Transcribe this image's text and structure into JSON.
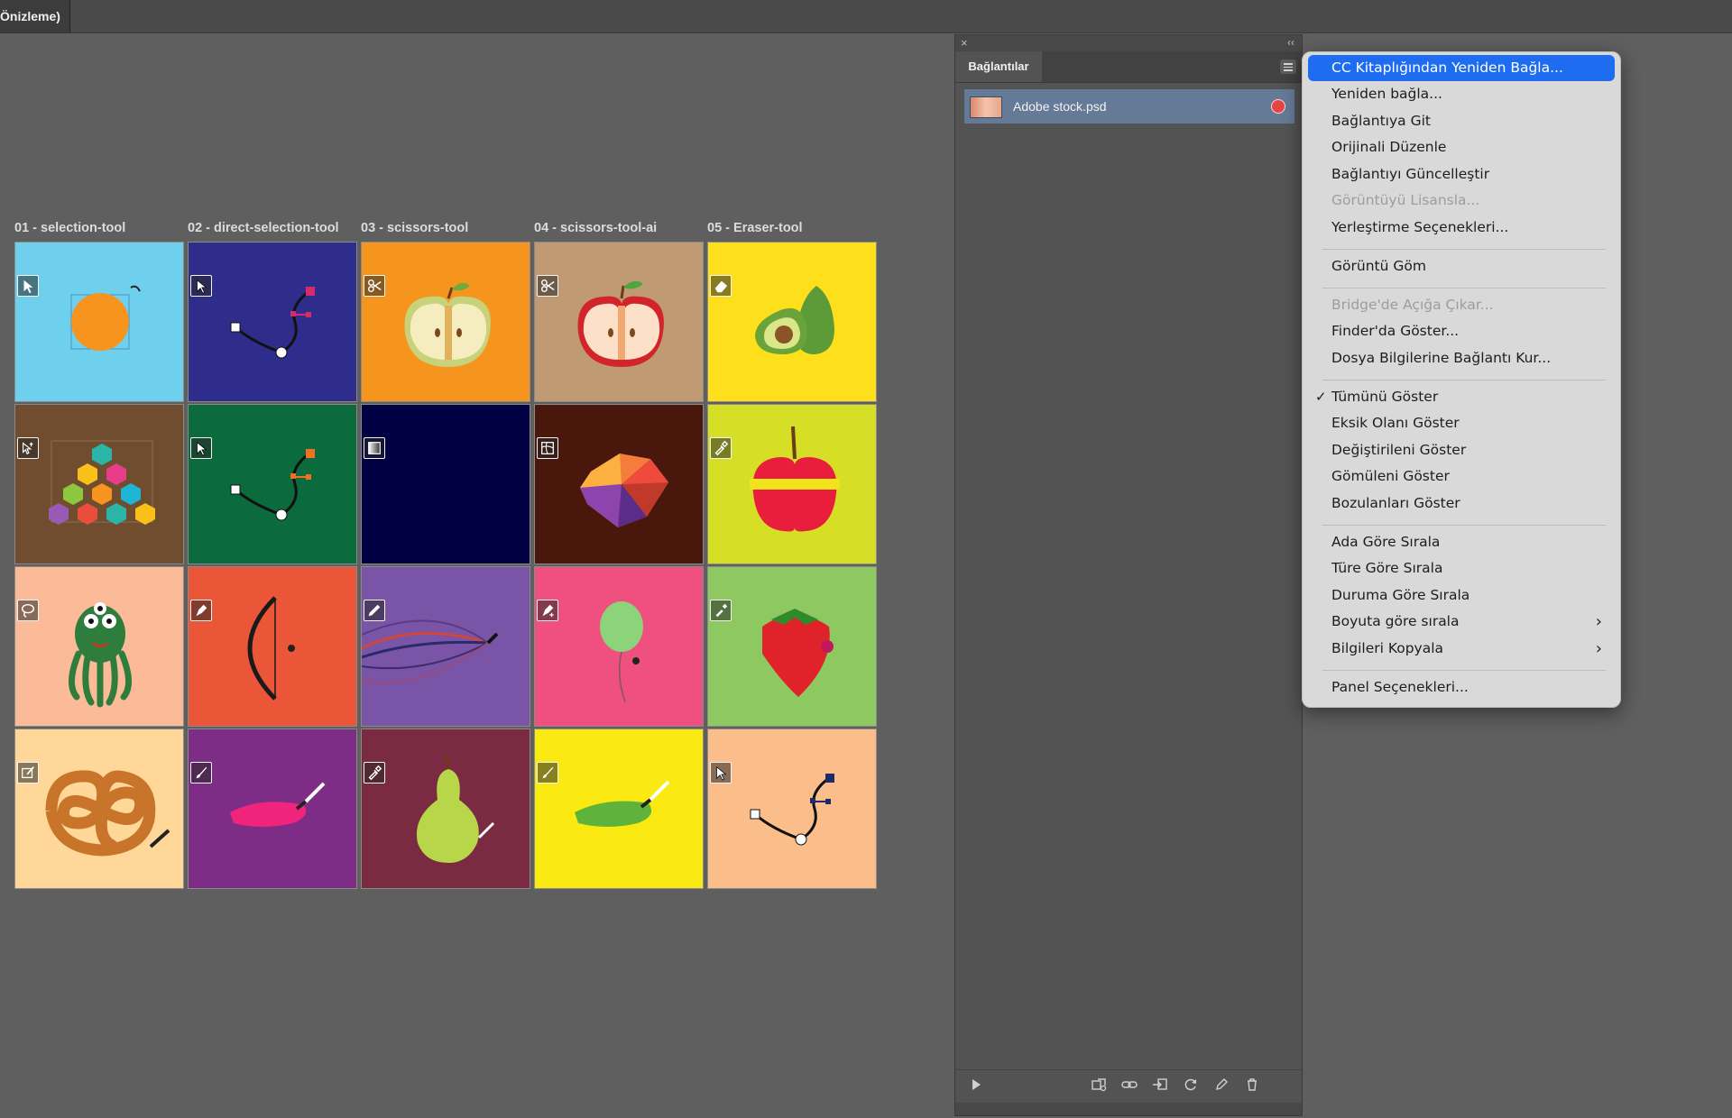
{
  "document": {
    "tab_title": "Önizleme)"
  },
  "artboards": {
    "labels": [
      "01 - selection-tool",
      "02 - direct-selection-tool",
      "03 - scissors-tool",
      "04 - scissors-tool-ai",
      "05 - Eraser-tool"
    ]
  },
  "tiles": [
    {
      "bg": "#6fd0ee",
      "badge": "selection-arrow",
      "art": "orange-circle"
    },
    {
      "bg": "#2f2d8c",
      "badge": "direct-selection-arrow",
      "art": "bezier-path"
    },
    {
      "bg": "#f6951e",
      "badge": "scissors",
      "art": "apple-half-green"
    },
    {
      "bg": "#bf9a72",
      "badge": "scissors",
      "art": "apple-half-red"
    },
    {
      "bg": "#fde01b",
      "badge": "eraser",
      "art": "avocados"
    },
    {
      "bg": "#6f4d2e",
      "badge": "group-selection",
      "art": "hexagons"
    },
    {
      "bg": "#0b6b3c",
      "badge": "direct-selection-arrow",
      "art": "bezier-path-orange"
    },
    {
      "bg": "#000043",
      "badge": "gradient",
      "art": "none"
    },
    {
      "bg": "#4a170c",
      "badge": "mesh",
      "art": "gem"
    },
    {
      "bg": "#d6df25",
      "badge": "eyedropper",
      "art": "apple-red"
    },
    {
      "bg": "#fcbb98",
      "badge": "lasso",
      "art": "octopus"
    },
    {
      "bg": "#ec5638",
      "badge": "pen",
      "art": "bow"
    },
    {
      "bg": "#7a55a7",
      "badge": "pencil",
      "art": "wires"
    },
    {
      "bg": "#ef5080",
      "badge": "pen-add",
      "art": "balloon"
    },
    {
      "bg": "#8dc860",
      "badge": "eyedropper-fill",
      "art": "strawberry"
    },
    {
      "bg": "#ffd899",
      "badge": "blob-brush",
      "art": "pretzel"
    },
    {
      "bg": "#7e2d86",
      "badge": "paintbrush",
      "art": "paint-pink"
    },
    {
      "bg": "#7a2b42",
      "badge": "eyedropper",
      "art": "pear"
    },
    {
      "bg": "#faea12",
      "badge": "paintbrush",
      "art": "paint-green"
    },
    {
      "bg": "#fbbd89",
      "badge": "direct-selection-arrow",
      "art": "bezier-path-navy"
    }
  ],
  "links_panel": {
    "tab_title": "Bağlantılar",
    "close_glyph": "×",
    "collapse_glyph": "‹‹",
    "items": [
      {
        "name": "Adobe stock.psd",
        "status": "modified"
      }
    ]
  },
  "context_menu": {
    "items": [
      {
        "label": "CC Kitaplığından Yeniden Bağla...",
        "state": "highlighted"
      },
      {
        "label": "Yeniden bağla...",
        "state": "enabled"
      },
      {
        "label": "Bağlantıya Git",
        "state": "enabled"
      },
      {
        "label": "Orijinali Düzenle",
        "state": "enabled"
      },
      {
        "label": "Bağlantıyı Güncelleştir",
        "state": "enabled"
      },
      {
        "label": "Görüntüyü Lisansla...",
        "state": "disabled"
      },
      {
        "label": "Yerleştirme Seçenekleri...",
        "state": "enabled"
      },
      {
        "label": "Görüntü Göm",
        "state": "enabled"
      },
      {
        "label": "Bridge'de Açığa Çıkar...",
        "state": "disabled"
      },
      {
        "label": "Finder'da Göster...",
        "state": "enabled"
      },
      {
        "label": "Dosya Bilgilerine Bağlantı Kur...",
        "state": "enabled"
      },
      {
        "label": "Tümünü Göster",
        "state": "checked"
      },
      {
        "label": "Eksik Olanı Göster",
        "state": "enabled"
      },
      {
        "label": "Değiştirileni Göster",
        "state": "enabled"
      },
      {
        "label": "Gömüleni Göster",
        "state": "enabled"
      },
      {
        "label": "Bozulanları Göster",
        "state": "enabled"
      },
      {
        "label": "Ada Göre Sırala",
        "state": "enabled"
      },
      {
        "label": "Türe Göre Sırala",
        "state": "enabled"
      },
      {
        "label": "Duruma Göre Sırala",
        "state": "enabled"
      },
      {
        "label": "Boyuta göre sırala",
        "state": "submenu"
      },
      {
        "label": "Bilgileri Kopyala",
        "state": "submenu"
      },
      {
        "label": "Panel Seçenekleri...",
        "state": "enabled"
      }
    ],
    "check_glyph": "✓",
    "submenu_glyph": "›"
  },
  "colors": {
    "menu_highlight": "#1e6cf0",
    "link_row": "#647a96",
    "canvas": "#5f5f5f"
  }
}
